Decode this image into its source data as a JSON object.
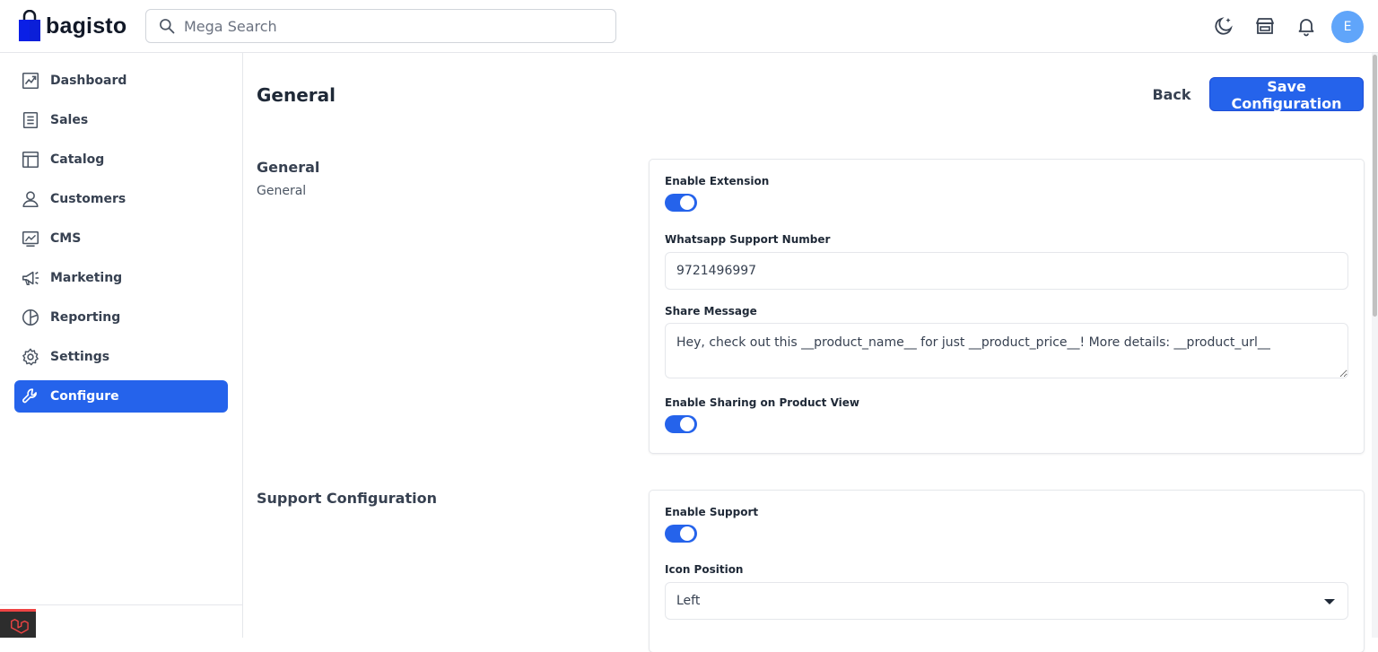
{
  "header": {
    "logo_text": "bagisto",
    "search_placeholder": "Mega Search",
    "avatar_initial": "E"
  },
  "sidebar": {
    "items": [
      {
        "label": "Dashboard",
        "icon": "dashboard-icon",
        "active": false
      },
      {
        "label": "Sales",
        "icon": "sales-icon",
        "active": false
      },
      {
        "label": "Catalog",
        "icon": "catalog-icon",
        "active": false
      },
      {
        "label": "Customers",
        "icon": "customers-icon",
        "active": false
      },
      {
        "label": "CMS",
        "icon": "cms-icon",
        "active": false
      },
      {
        "label": "Marketing",
        "icon": "marketing-icon",
        "active": false
      },
      {
        "label": "Reporting",
        "icon": "reporting-icon",
        "active": false
      },
      {
        "label": "Settings",
        "icon": "settings-icon",
        "active": false
      },
      {
        "label": "Configure",
        "icon": "configure-icon",
        "active": true
      }
    ]
  },
  "page": {
    "title": "General",
    "back_label": "Back",
    "save_label": "Save Configuration"
  },
  "sections": {
    "general": {
      "title": "General",
      "subtitle": "General",
      "fields": {
        "enable_extension_label": "Enable Extension",
        "enable_extension_value": true,
        "whatsapp_label": "Whatsapp Support Number",
        "whatsapp_value": "9721496997",
        "share_message_label": "Share Message",
        "share_message_value": "Hey, check out this __product_name__ for just __product_price__! More details: __product_url__",
        "enable_sharing_label": "Enable Sharing on Product View",
        "enable_sharing_value": true
      }
    },
    "support": {
      "title": "Support Configuration",
      "fields": {
        "enable_support_label": "Enable Support",
        "enable_support_value": true,
        "icon_position_label": "Icon Position",
        "icon_position_value": "Left"
      }
    }
  },
  "colors": {
    "accent": "#2563eb",
    "avatar": "#60a5fa",
    "border": "#e5e7eb"
  }
}
